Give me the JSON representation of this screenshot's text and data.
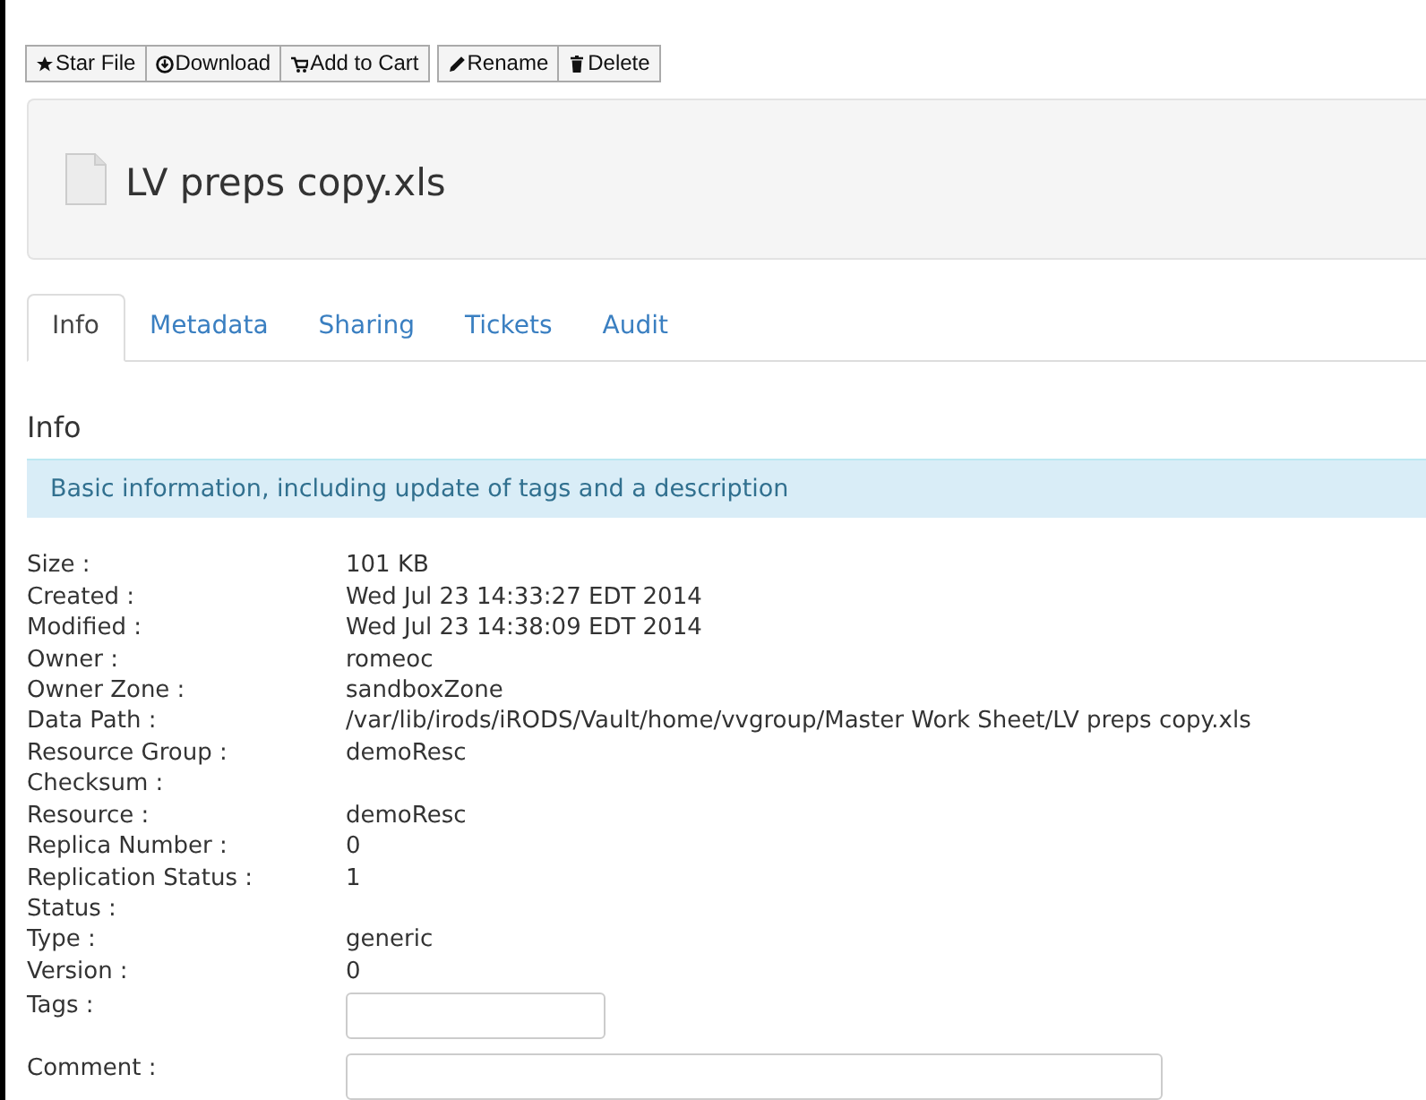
{
  "toolbar": {
    "groups": [
      [
        {
          "label": "Star File",
          "kind": "star"
        },
        {
          "label": "Download",
          "kind": "download"
        },
        {
          "label": "Add to Cart",
          "kind": "cart"
        }
      ],
      [
        {
          "label": "Rename",
          "kind": "pencil"
        },
        {
          "label": "Delete",
          "kind": "trash"
        }
      ]
    ]
  },
  "file": {
    "name": "LV preps copy.xls"
  },
  "tabs": [
    {
      "label": "Info",
      "selected": true
    },
    {
      "label": "Metadata",
      "selected": false
    },
    {
      "label": "Sharing",
      "selected": false
    },
    {
      "label": "Tickets",
      "selected": false
    },
    {
      "label": "Audit",
      "selected": false
    }
  ],
  "section": {
    "title": "Info",
    "description": "Basic information, including update of tags and a description"
  },
  "details": [
    {
      "label": "Size :",
      "value": "101 KB"
    },
    {
      "label": "Created :",
      "value": "Wed Jul 23 14:33:27 EDT 2014"
    },
    {
      "label": "Modified :",
      "value": "Wed Jul 23 14:38:09 EDT 2014"
    },
    {
      "label": "Owner :",
      "value": "romeoc"
    },
    {
      "label": "Owner Zone :",
      "value": "sandboxZone"
    },
    {
      "label": "Data Path :",
      "value": "/var/lib/irods/iRODS/Vault/home/vvgroup/Master Work Sheet/LV preps copy.xls"
    },
    {
      "label": "Resource Group :",
      "value": "demoResc"
    },
    {
      "label": "Checksum :"
    },
    {
      "label": "Resource :",
      "value": "demoResc"
    },
    {
      "label": "Replica Number :",
      "value": "0"
    },
    {
      "label": "Replication Status :",
      "value": "1"
    },
    {
      "label": "Status :"
    },
    {
      "label": "Type :",
      "value": "generic"
    },
    {
      "label": "Version :",
      "value": "0"
    }
  ],
  "fields": [
    {
      "label": "Tags :",
      "kind": "short"
    },
    {
      "label": "Comment :",
      "kind": "long"
    }
  ]
}
